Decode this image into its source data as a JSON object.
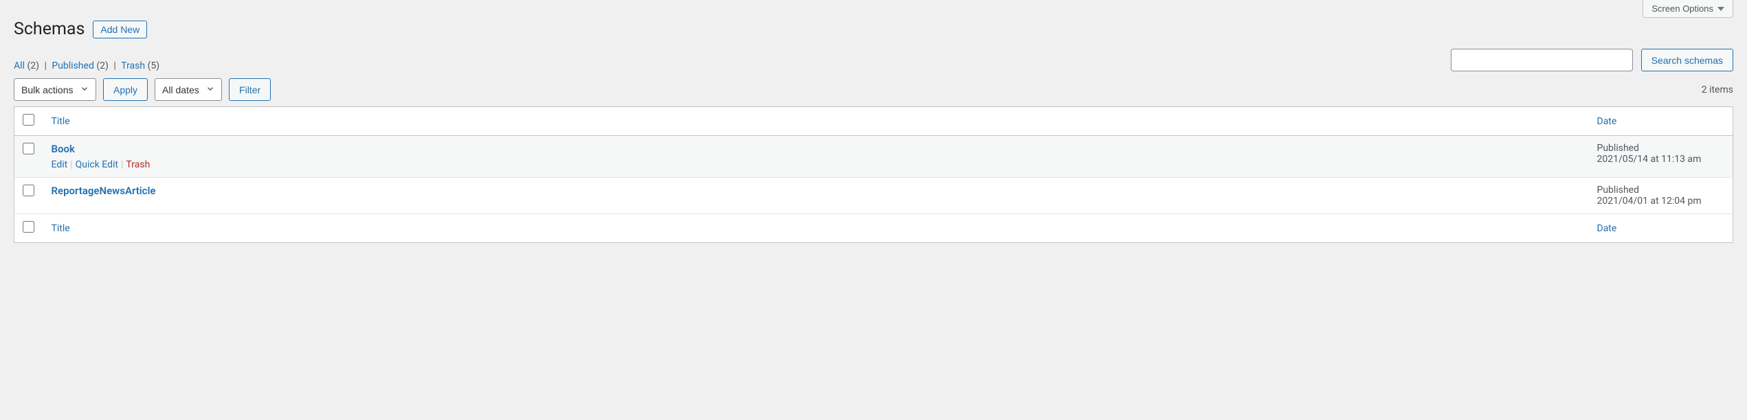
{
  "screen_options": {
    "label": "Screen Options"
  },
  "heading": "Schemas",
  "add_new": "Add New",
  "filter_links": {
    "all_label": "All",
    "all_count": "(2)",
    "published_label": "Published",
    "published_count": "(2)",
    "trash_label": "Trash",
    "trash_count": "(5)"
  },
  "search": {
    "button": "Search schemas"
  },
  "bulk_actions": {
    "label": "Bulk actions",
    "apply": "Apply"
  },
  "dates": {
    "label": "All dates",
    "filter": "Filter"
  },
  "items_count": "2 items",
  "columns": {
    "title": "Title",
    "date": "Date"
  },
  "row_actions": {
    "edit": "Edit",
    "quick_edit": "Quick Edit",
    "trash": "Trash"
  },
  "rows": [
    {
      "title": "Book",
      "status": "Published",
      "date": "2021/05/14 at 11:13 am",
      "show_actions": true
    },
    {
      "title": "ReportageNewsArticle",
      "status": "Published",
      "date": "2021/04/01 at 12:04 pm",
      "show_actions": false
    }
  ]
}
